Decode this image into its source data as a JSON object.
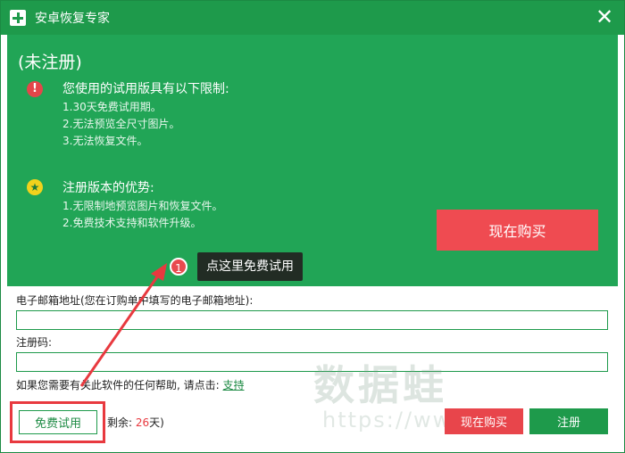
{
  "window": {
    "title": "安卓恢复专家",
    "close_glyph": "✕"
  },
  "banner": {
    "status": "(未注册)",
    "limits_heading": "您使用的试用版具有以下限制:",
    "limits": [
      "1.30天免费试用期。",
      "2.无法预览全尺寸图片。",
      "3.无法恢复文件。"
    ],
    "benefits_heading": "注册版本的优势:",
    "benefits": [
      "1.无限制地预览图片和恢复文件。",
      "2.免费技术支持和软件升级。"
    ],
    "buy_now_label": "现在购买"
  },
  "callout": {
    "number": "1",
    "text": "点这里免费试用"
  },
  "form": {
    "email_label": "电子邮箱地址(您在订购单中填写的电子邮箱地址):",
    "email_value": "",
    "code_label": "注册码:",
    "code_value": "",
    "help_text": "如果您需要有关此软件的任何帮助, 请点击: ",
    "help_link": "支持"
  },
  "bottom": {
    "free_trial_label": "免费试用",
    "remaining_prefix": "剩余: ",
    "remaining_days": "26",
    "remaining_suffix": "天)",
    "buy_now_label": "现在购买",
    "register_label": "注册"
  },
  "watermark": {
    "text": "数据蛙",
    "url": "https://www"
  },
  "colors": {
    "green": "#1e9a4b",
    "red": "#e8393f",
    "banner": "#21a556"
  }
}
